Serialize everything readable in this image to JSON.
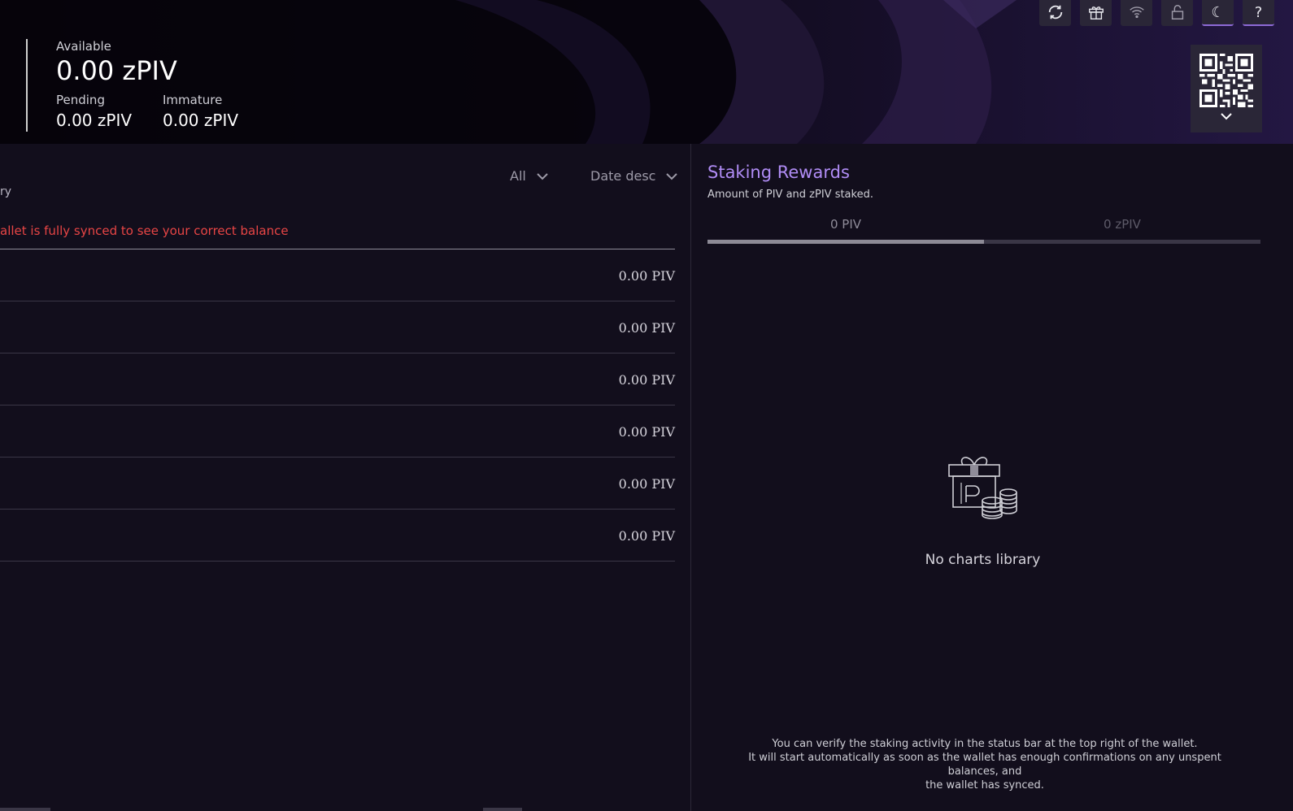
{
  "header": {
    "available_label": "Available",
    "available_value": "0.00 zPIV",
    "pending_label": "Pending",
    "pending_value": "0.00 zPIV",
    "immature_label": "Immature",
    "immature_value": "0.00 zPIV"
  },
  "toolbar": {
    "buttons": [
      {
        "icon": "refresh-icon"
      },
      {
        "icon": "gift-icon"
      },
      {
        "icon": "network-icon"
      },
      {
        "icon": "lock-open-icon"
      },
      {
        "icon": "moon-icon",
        "label": "☾"
      },
      {
        "icon": "help-icon",
        "label": "?"
      }
    ]
  },
  "qr": {
    "icon": "qr-code-icon",
    "expand_icon": "chevron-down-icon"
  },
  "transactions": {
    "filter_type": "All",
    "filter_sort": "Date desc",
    "cropped_label": "ry",
    "sync_warning": "allet is fully synced to see your correct balance",
    "rows": [
      {
        "amount": "0.00 PIV"
      },
      {
        "amount": "0.00 PIV"
      },
      {
        "amount": "0.00 PIV"
      },
      {
        "amount": "0.00 PIV"
      },
      {
        "amount": "0.00 PIV"
      },
      {
        "amount": "0.00 PIV"
      }
    ]
  },
  "staking": {
    "title": "Staking Rewards",
    "subtitle": "Amount of PIV and zPIV staked.",
    "tabs": [
      "0 PIV",
      "0 zPIV"
    ],
    "empty_icon": "gift-coins-icon",
    "empty_text": "No charts library",
    "note_line1": "You can verify the staking activity in the status bar at the top right of the wallet.",
    "note_line2": "It will start automatically as soon as the wallet has enough confirmations on any unspent balances, and",
    "note_line3": "the wallet has synced."
  },
  "colors": {
    "accent": "#b08cf5",
    "warning": "#e84545",
    "background": "#120e1c"
  }
}
